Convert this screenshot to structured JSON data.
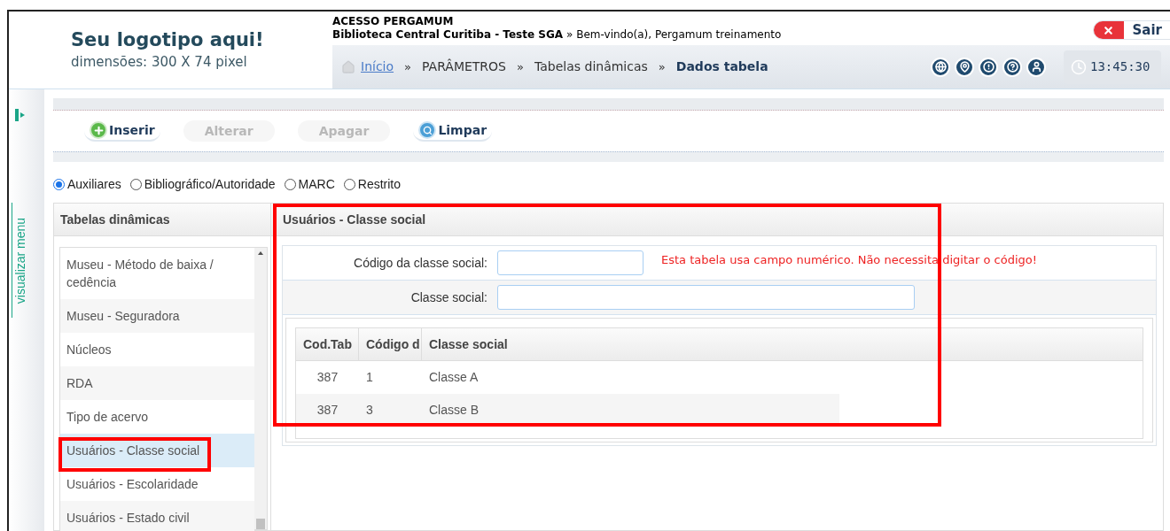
{
  "logo": {
    "title": "Seu logotipo aqui!",
    "subtitle": "dimensões: 300 X 74 pixel"
  },
  "header": {
    "system": "ACESSO PERGAMUM",
    "library": "Biblioteca Central Curitiba - Teste SGA",
    "welcome": "» Bem-vindo(a), Pergamum treinamento",
    "exit_button": "Sair",
    "clock": "13:45:30"
  },
  "breadcrumb": [
    {
      "label": "Início",
      "kind": "link"
    },
    {
      "label": "»",
      "kind": "separator"
    },
    {
      "label": "PARÂMETROS",
      "kind": "text"
    },
    {
      "label": "»",
      "kind": "separator"
    },
    {
      "label": "Tabelas dinâmicas",
      "kind": "text"
    },
    {
      "label": "»",
      "kind": "separator"
    },
    {
      "label": "Dados tabela",
      "kind": "current"
    }
  ],
  "side_menu": {
    "label": "visualizar menu"
  },
  "toolbar": [
    {
      "label": "Inserir",
      "disabled": false
    },
    {
      "label": "Alterar",
      "disabled": true
    },
    {
      "label": "Apagar",
      "disabled": true
    },
    {
      "label": "Limpar",
      "disabled": false
    }
  ],
  "table_types": [
    {
      "label": "Auxiliares",
      "selected": true
    },
    {
      "label": "Bibliográfico/Autoridade",
      "selected": false
    },
    {
      "label": "MARC",
      "selected": false
    },
    {
      "label": "Restrito",
      "selected": false
    }
  ],
  "tables_panel": {
    "title": "Tabelas dinâmicas",
    "items": [
      {
        "label": "Museu - Método de baixa / cedência",
        "selected": false
      },
      {
        "label": "Museu - Seguradora",
        "selected": false
      },
      {
        "label": "Núcleos",
        "selected": false
      },
      {
        "label": "RDA",
        "selected": false
      },
      {
        "label": "Tipo de acervo",
        "selected": false
      },
      {
        "label": "Usuários - Classe social",
        "selected": true
      },
      {
        "label": "Usuários - Escolaridade",
        "selected": false
      },
      {
        "label": "Usuários - Estado civil",
        "selected": false
      }
    ]
  },
  "detail_panel": {
    "title": "Usuários - Classe social",
    "fields": [
      {
        "label": "Código da classe social:",
        "message": "Esta tabela usa campo numérico. Não necessita digitar o código!"
      },
      {
        "label": "Classe social:"
      }
    ],
    "table": {
      "columns": [
        "Cod.Tab",
        "Código d",
        "Classe social"
      ],
      "rows": [
        [
          "387",
          "1",
          "Classe A"
        ],
        [
          "387",
          "3",
          "Classe B"
        ]
      ]
    }
  }
}
